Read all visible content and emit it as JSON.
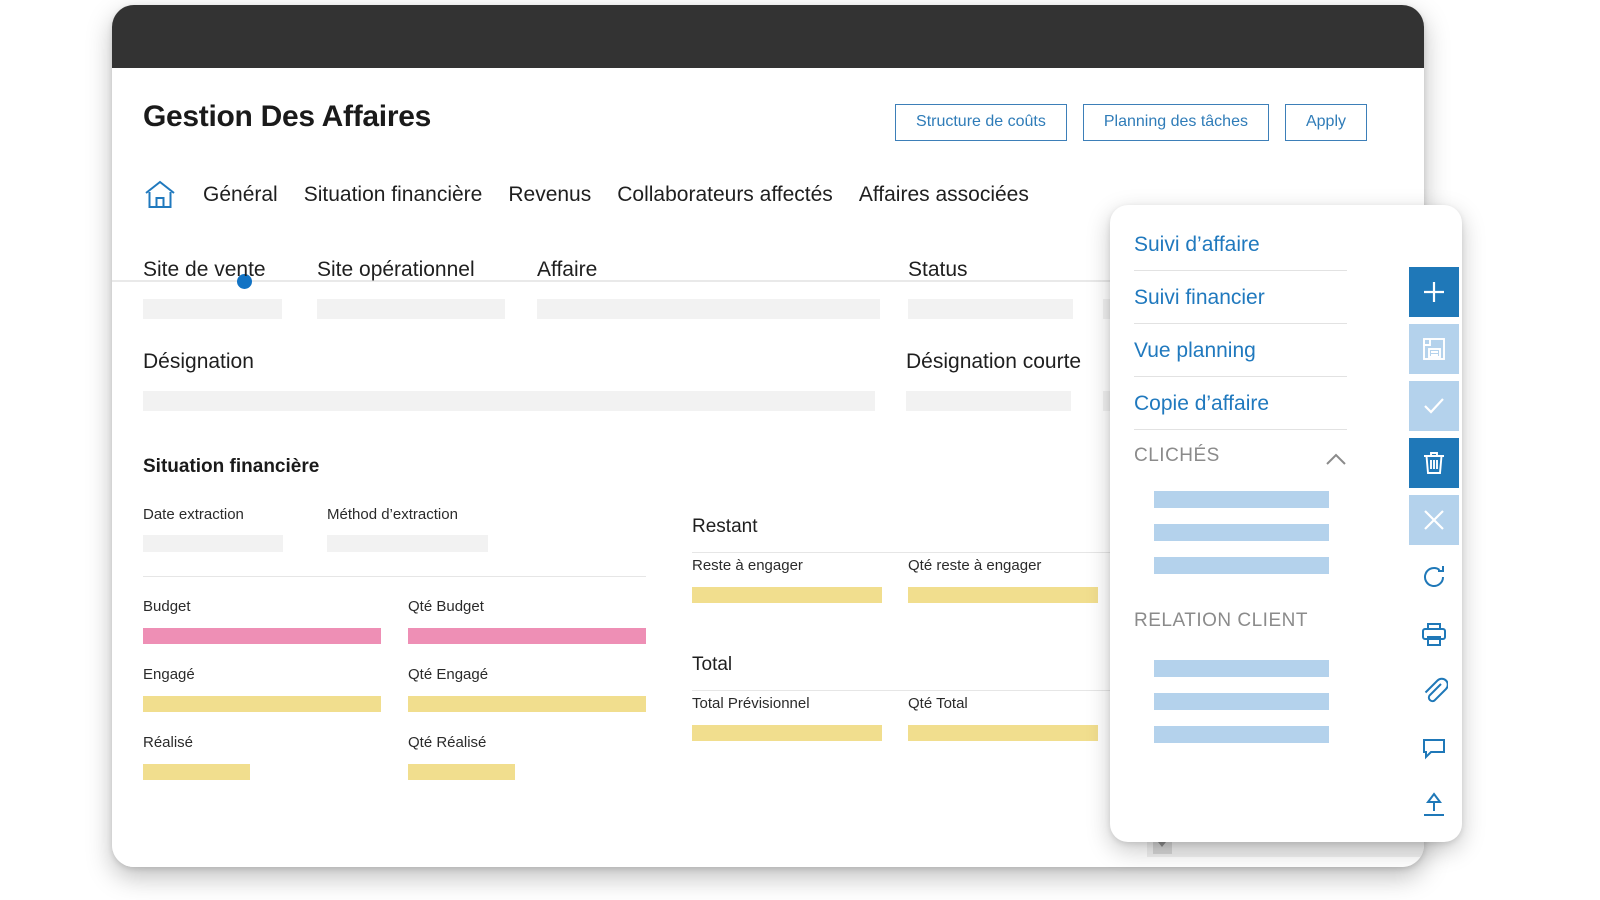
{
  "header": {
    "title": "Gestion Des Affaires",
    "actions": [
      {
        "label": "Structure de coûts"
      },
      {
        "label": "Planning des tâches"
      },
      {
        "label": "Apply"
      }
    ]
  },
  "nav": {
    "home_icon": "home-icon",
    "tabs": [
      {
        "label": "Général",
        "active": true
      },
      {
        "label": "Situation financière",
        "active": false
      },
      {
        "label": "Revenus",
        "active": false
      },
      {
        "label": "Collaborateurs affectés",
        "active": false
      },
      {
        "label": "Affaires associées",
        "active": false
      }
    ]
  },
  "form": {
    "row1": [
      {
        "label": "Site de vente",
        "value": ""
      },
      {
        "label": "Site opérationnel",
        "value": ""
      },
      {
        "label": "Affaire",
        "value": ""
      },
      {
        "label": "Status",
        "value": ""
      }
    ],
    "row2": [
      {
        "label": "Désignation",
        "value": ""
      },
      {
        "label": "Désignation courte",
        "value": ""
      }
    ]
  },
  "financial": {
    "title": "Situation financière",
    "meta": [
      {
        "label": "Date extraction",
        "value": ""
      },
      {
        "label": "Méthod d’extraction",
        "value": ""
      }
    ],
    "left_cells": [
      {
        "label": "Budget",
        "bar": "pink"
      },
      {
        "label": "Qté Budget",
        "bar": "pink"
      },
      {
        "label": "Engagé",
        "bar": "yellow"
      },
      {
        "label": "Qté Engagé",
        "bar": "yellow"
      },
      {
        "label": "Réalisé",
        "bar": "yellow"
      },
      {
        "label": "Qté Réalisé",
        "bar": "yellow"
      }
    ],
    "restant": {
      "title": "Restant",
      "cells": [
        {
          "label": "Reste à engager",
          "bar": "yellow"
        },
        {
          "label": "Qté reste à engager",
          "bar": "yellow"
        }
      ]
    },
    "total": {
      "title": "Total",
      "cells": [
        {
          "label": "Total Prévisionnel",
          "bar": "yellow"
        },
        {
          "label": "Qté Total",
          "bar": "yellow"
        }
      ]
    }
  },
  "side_panel": {
    "links": [
      {
        "label": "Suivi d’affaire"
      },
      {
        "label": "Suivi financier"
      },
      {
        "label": "Vue planning"
      },
      {
        "label": "Copie d’affaire"
      }
    ],
    "sections": [
      {
        "label": "CLICHÉS",
        "collapse_icon": "chevron-up-icon",
        "placeholder_rows": 3
      },
      {
        "label": "RELATION CLIENT",
        "collapse_icon": "",
        "placeholder_rows": 3
      }
    ],
    "toolbar": [
      {
        "icon": "plus-icon",
        "state": "solid"
      },
      {
        "icon": "save-icon",
        "state": "muted"
      },
      {
        "icon": "check-icon",
        "state": "muted"
      },
      {
        "icon": "trash-icon",
        "state": "solid"
      },
      {
        "icon": "close-icon",
        "state": "muted"
      },
      {
        "icon": "refresh-icon",
        "state": "plain"
      },
      {
        "icon": "print-icon",
        "state": "plain"
      },
      {
        "icon": "attachment-icon",
        "state": "plain"
      },
      {
        "icon": "comment-icon",
        "state": "plain"
      },
      {
        "icon": "upload-icon",
        "state": "plain"
      }
    ]
  },
  "colors": {
    "accent": "#1f78b8",
    "link": "#2079be",
    "bar_pink": "#ee8fb5",
    "bar_yellow": "#f1de8e",
    "placeholder_blue": "#b4d2ec",
    "field_grey": "#f2f2f2",
    "titlebar": "#333333"
  },
  "scrollbar": {
    "arrow_icon": "caret-down-icon"
  }
}
